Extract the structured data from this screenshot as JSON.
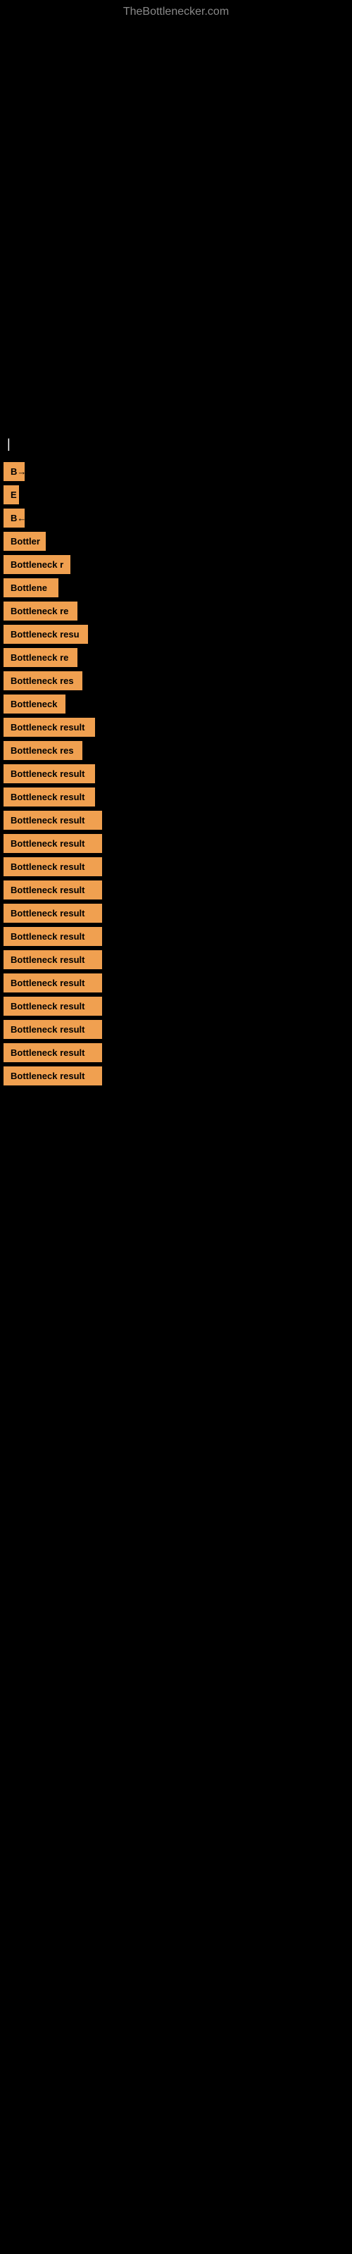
{
  "site": {
    "title": "TheBottlenecker.com"
  },
  "section": {
    "label": "|"
  },
  "items": [
    {
      "label": "B→",
      "width": 30
    },
    {
      "label": "E",
      "width": 22
    },
    {
      "label": "B←",
      "width": 30
    },
    {
      "label": "Bottler",
      "width": 60
    },
    {
      "label": "Bottleneck r",
      "width": 95
    },
    {
      "label": "Bottlene",
      "width": 78
    },
    {
      "label": "Bottleneck re",
      "width": 105
    },
    {
      "label": "Bottleneck resu",
      "width": 120
    },
    {
      "label": "Bottleneck re",
      "width": 105
    },
    {
      "label": "Bottleneck res",
      "width": 112
    },
    {
      "label": "Bottleneck",
      "width": 88
    },
    {
      "label": "Bottleneck result",
      "width": 130
    },
    {
      "label": "Bottleneck res",
      "width": 112
    },
    {
      "label": "Bottleneck result",
      "width": 130
    },
    {
      "label": "Bottleneck result",
      "width": 130
    },
    {
      "label": "Bottleneck result",
      "width": 140
    },
    {
      "label": "Bottleneck result",
      "width": 140
    },
    {
      "label": "Bottleneck result",
      "width": 140
    },
    {
      "label": "Bottleneck result",
      "width": 140
    },
    {
      "label": "Bottleneck result",
      "width": 140
    },
    {
      "label": "Bottleneck result",
      "width": 140
    },
    {
      "label": "Bottleneck result",
      "width": 140
    },
    {
      "label": "Bottleneck result",
      "width": 140
    },
    {
      "label": "Bottleneck result",
      "width": 140
    },
    {
      "label": "Bottleneck result",
      "width": 140
    },
    {
      "label": "Bottleneck result",
      "width": 140
    },
    {
      "label": "Bottleneck result",
      "width": 140
    }
  ]
}
